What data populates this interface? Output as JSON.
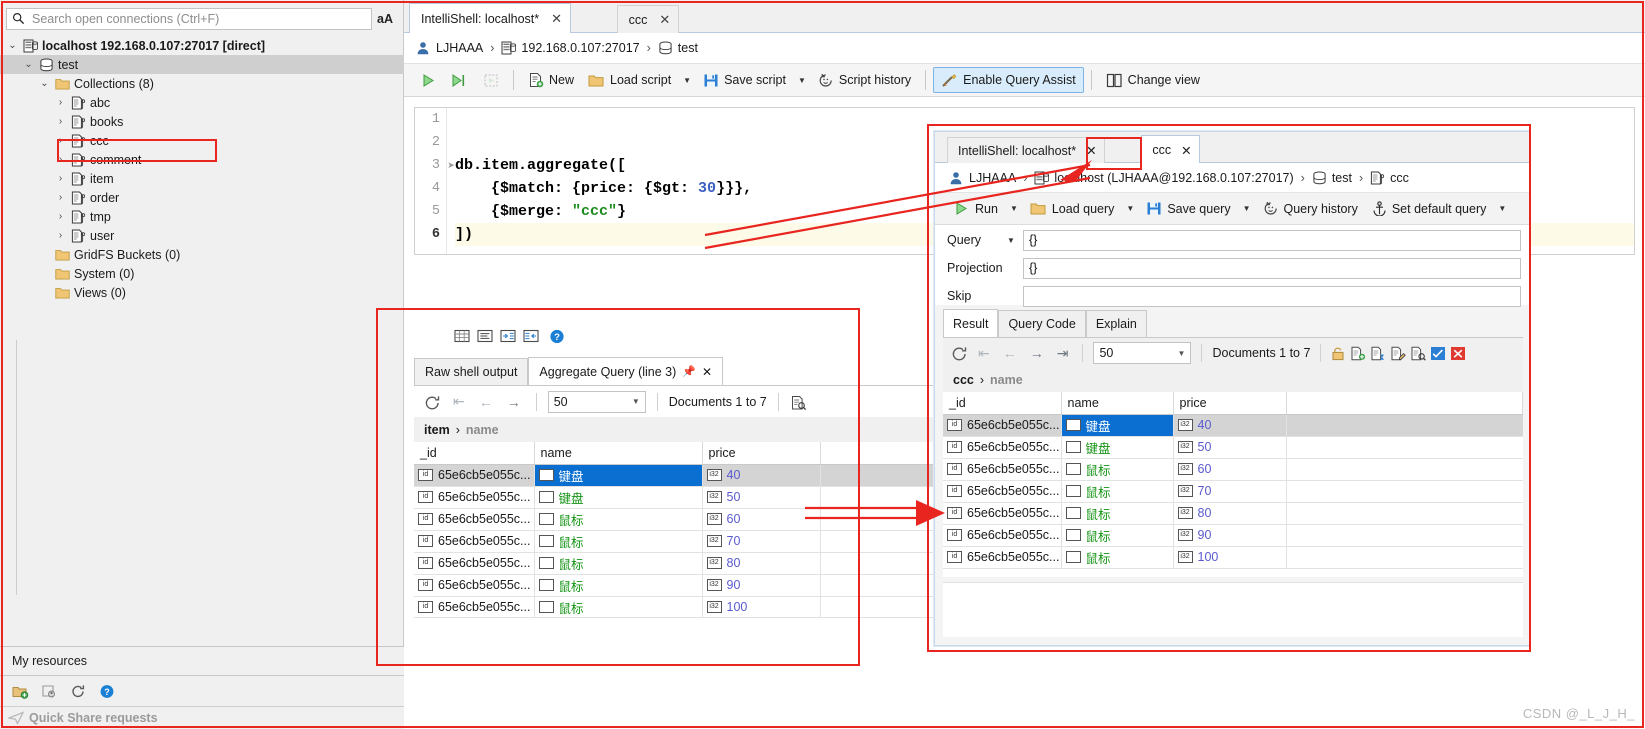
{
  "sidebar": {
    "search_placeholder": "Search open connections (Ctrl+F)",
    "search_icon": "search-icon",
    "font_toggle_label": "aA",
    "tree": [
      {
        "label": "localhost 192.168.0.107:27017 [direct]",
        "icon": "server-icon",
        "twisty": "⌄",
        "depth": 0,
        "bold": true,
        "selected": false
      },
      {
        "label": "test",
        "icon": "database-icon",
        "twisty": "⌄",
        "depth": 1,
        "bold": false,
        "selected": true
      },
      {
        "label": "Collections (8)",
        "icon": "folder-icon",
        "twisty": "⌄",
        "depth": 2,
        "bold": false,
        "selected": false
      },
      {
        "label": "abc",
        "icon": "collection-icon",
        "twisty": "›",
        "depth": 3,
        "bold": false,
        "selected": false
      },
      {
        "label": "books",
        "icon": "collection-icon",
        "twisty": "›",
        "depth": 3,
        "bold": false,
        "selected": false
      },
      {
        "label": "ccc",
        "icon": "collection-icon",
        "twisty": "›",
        "depth": 3,
        "bold": false,
        "selected": false
      },
      {
        "label": "comment",
        "icon": "collection-icon",
        "twisty": "›",
        "depth": 3,
        "bold": false,
        "selected": false
      },
      {
        "label": "item",
        "icon": "collection-icon",
        "twisty": "›",
        "depth": 3,
        "bold": false,
        "selected": false
      },
      {
        "label": "order",
        "icon": "collection-icon",
        "twisty": "›",
        "depth": 3,
        "bold": false,
        "selected": false
      },
      {
        "label": "tmp",
        "icon": "collection-icon",
        "twisty": "›",
        "depth": 3,
        "bold": false,
        "selected": false
      },
      {
        "label": "user",
        "icon": "collection-icon",
        "twisty": "›",
        "depth": 3,
        "bold": false,
        "selected": false
      },
      {
        "label": "GridFS Buckets (0)",
        "icon": "folder-icon",
        "twisty": "",
        "depth": 2,
        "bold": false,
        "selected": false
      },
      {
        "label": "System (0)",
        "icon": "folder-icon",
        "twisty": "",
        "depth": 2,
        "bold": false,
        "selected": false
      },
      {
        "label": "Views (0)",
        "icon": "folder-icon",
        "twisty": "",
        "depth": 2,
        "bold": false,
        "selected": false
      }
    ],
    "my_resources_label": "My resources",
    "bottom_icons": [
      "new-folder-icon",
      "add-connection-icon",
      "refresh-icon",
      "help-icon"
    ],
    "quick_share_label": "Quick Share requests",
    "quick_share_icon": "send-icon"
  },
  "main": {
    "tabs": [
      {
        "label": "IntelliShell: localhost*",
        "active": true,
        "close": "✕"
      },
      {
        "label": "ccc",
        "active": false,
        "close": "✕"
      }
    ],
    "breadcrumb": [
      {
        "text": "LJHAAA",
        "icon": "user-icon"
      },
      {
        "text": "192.168.0.107:27017",
        "icon": "server-icon"
      },
      {
        "text": "test",
        "icon": "database-icon"
      }
    ],
    "toolbar": {
      "run_icon": "play-icon",
      "run_to_icon": "play-to-cursor-icon",
      "stop_icon": "stop-icon",
      "new_label": "New",
      "new_icon": "new-script-icon",
      "load_label": "Load script",
      "load_icon": "folder-open-icon",
      "save_label": "Save script",
      "save_icon": "save-icon",
      "history_label": "Script history",
      "history_icon": "history-icon",
      "query_assist_label": "Enable Query Assist",
      "query_assist_icon": "magic-wand-icon",
      "change_view_label": "Change view",
      "change_view_icon": "split-view-icon"
    },
    "editor": {
      "line_numbers": [
        "1",
        "2",
        "3",
        "4",
        "5",
        "6"
      ],
      "current_line": 6,
      "lines": [
        "",
        "",
        "db.item.aggregate([",
        "    {$match: {price: {$gt: 30}}},",
        "    {$merge: \"ccc\"}",
        "])"
      ]
    },
    "grid_icons": [
      "expand-rows-icon",
      "text-view-icon",
      "expand-all-icon",
      "collapse-all-icon",
      "help-icon"
    ],
    "output_tabs": [
      {
        "label": "Raw shell output",
        "active": false,
        "pin": false,
        "close": false
      },
      {
        "label": "Aggregate Query (line 3)",
        "active": true,
        "pin": true,
        "close": true
      }
    ],
    "output_toolbar": {
      "refresh_icon": "refresh-icon",
      "first_icon": "⇤",
      "prev_icon": "←",
      "next_icon": "→",
      "page_size": "50",
      "doc_count": "Documents 1 to 7",
      "inspect_icon": "document-search-icon"
    },
    "result_crumb": {
      "collection": "item",
      "sep": "›",
      "field": "name"
    },
    "result_table": {
      "columns": [
        "_id",
        "name",
        "price"
      ],
      "rows": [
        {
          "_id": "65e6cb5e055c...",
          "name": "键盘",
          "price": "40",
          "selected": true
        },
        {
          "_id": "65e6cb5e055c...",
          "name": "键盘",
          "price": "50",
          "selected": false
        },
        {
          "_id": "65e6cb5e055c...",
          "name": "鼠标",
          "price": "60",
          "selected": false
        },
        {
          "_id": "65e6cb5e055c...",
          "name": "鼠标",
          "price": "70",
          "selected": false
        },
        {
          "_id": "65e6cb5e055c...",
          "name": "鼠标",
          "price": "80",
          "selected": false
        },
        {
          "_id": "65e6cb5e055c...",
          "name": "鼠标",
          "price": "90",
          "selected": false
        },
        {
          "_id": "65e6cb5e055c...",
          "name": "鼠标",
          "price": "100",
          "selected": false
        }
      ]
    }
  },
  "float_panel": {
    "tabs": [
      {
        "label": "IntelliShell: localhost*",
        "active": false,
        "close": "✕"
      },
      {
        "label": "ccc",
        "active": true,
        "close": "✕"
      }
    ],
    "breadcrumb": [
      {
        "text": "LJHAAA",
        "icon": "user-icon"
      },
      {
        "text": "localhost (LJHAAA@192.168.0.107:27017)",
        "icon": "server-icon"
      },
      {
        "text": "test",
        "icon": "database-icon"
      },
      {
        "text": "ccc",
        "icon": "collection-icon"
      }
    ],
    "toolbar": {
      "run_label": "Run",
      "run_icon": "play-icon",
      "load_label": "Load query",
      "load_icon": "folder-open-icon",
      "save_label": "Save query",
      "save_icon": "save-icon",
      "history_label": "Query history",
      "history_icon": "history-icon",
      "default_query_label": "Set default query",
      "default_query_icon": "anchor-icon"
    },
    "form": [
      {
        "label": "Query",
        "value": "{}",
        "has_caret": true
      },
      {
        "label": "Projection",
        "value": "{}",
        "has_caret": false
      },
      {
        "label": "Skip",
        "value": "",
        "has_caret": false
      }
    ],
    "result_tabs": [
      {
        "label": "Result",
        "active": true
      },
      {
        "label": "Query Code",
        "active": false
      },
      {
        "label": "Explain",
        "active": false
      }
    ],
    "result_toolbar": {
      "refresh_icon": "refresh-icon",
      "first_icon": "⇤",
      "prev_icon": "←",
      "next_icon": "→",
      "last_icon": "⇥",
      "page_size": "50",
      "doc_count": "Documents 1 to 7",
      "action_icons": [
        "lock-icon",
        "add-document-icon",
        "clone-document-icon",
        "edit-document-icon",
        "view-document-icon",
        "confirm-icon",
        "cancel-icon"
      ]
    },
    "result_crumb": {
      "collection": "ccc",
      "sep": "›",
      "field": "name"
    },
    "result_table": {
      "columns": [
        "_id",
        "name",
        "price"
      ],
      "rows": [
        {
          "_id": "65e6cb5e055c...",
          "name": "键盘",
          "price": "40",
          "selected": true
        },
        {
          "_id": "65e6cb5e055c...",
          "name": "键盘",
          "price": "50",
          "selected": false
        },
        {
          "_id": "65e6cb5e055c...",
          "name": "鼠标",
          "price": "60",
          "selected": false
        },
        {
          "_id": "65e6cb5e055c...",
          "name": "鼠标",
          "price": "70",
          "selected": false
        },
        {
          "_id": "65e6cb5e055c...",
          "name": "鼠标",
          "price": "80",
          "selected": false
        },
        {
          "_id": "65e6cb5e055c...",
          "name": "鼠标",
          "price": "90",
          "selected": false
        },
        {
          "_id": "65e6cb5e055c...",
          "name": "鼠标",
          "price": "100",
          "selected": false
        }
      ]
    }
  },
  "annotations": {
    "color": "#e8251f",
    "watermark": "CSDN @_L_J_H_"
  }
}
